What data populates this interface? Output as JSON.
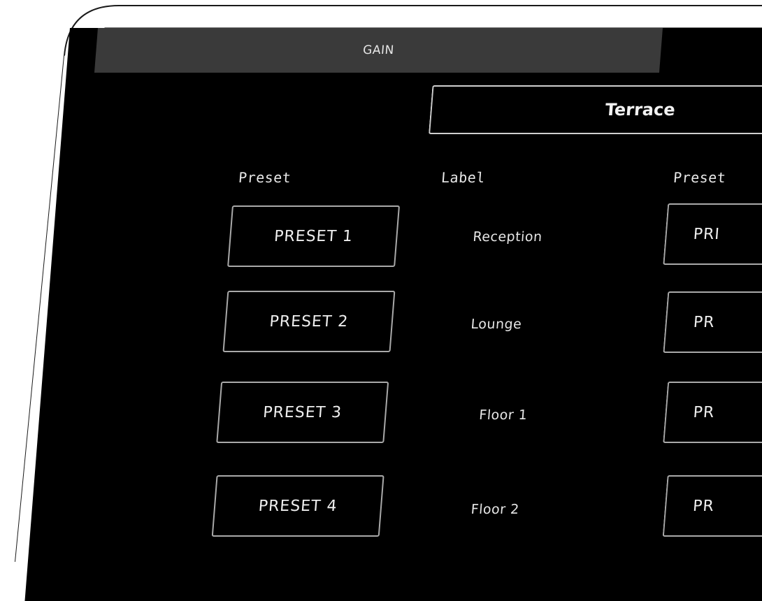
{
  "header": {
    "gain_tab_label": "GAIN"
  },
  "zone": {
    "title": "Terrace"
  },
  "columns": {
    "preset_header": "Preset",
    "label_header": "Label",
    "preset_header_right": "Preset"
  },
  "rows": [
    {
      "preset_label": "PRESET 1",
      "label": "Reception",
      "right_preset_label": "PRI"
    },
    {
      "preset_label": "PRESET 2",
      "label": "Lounge",
      "right_preset_label": "PR"
    },
    {
      "preset_label": "PRESET 3",
      "label": "Floor 1",
      "right_preset_label": "PR"
    },
    {
      "preset_label": "PRESET 4",
      "label": "Floor 2",
      "right_preset_label": "PR"
    }
  ]
}
